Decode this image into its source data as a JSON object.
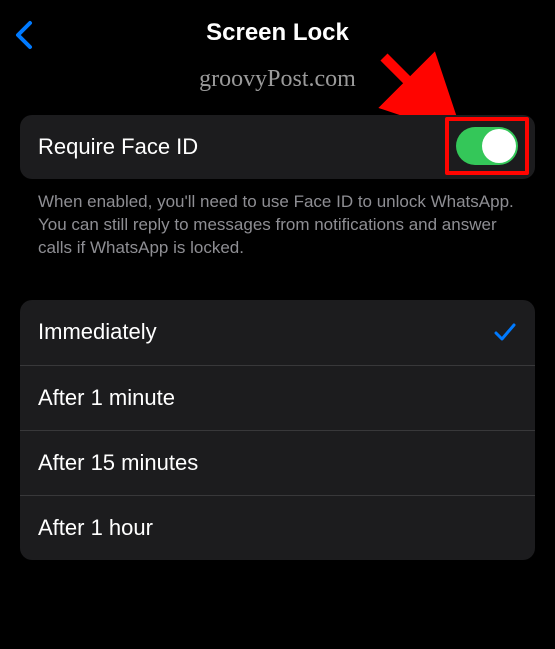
{
  "header": {
    "title": "Screen Lock"
  },
  "watermark": "groovyPost.com",
  "setting": {
    "label": "Require Face ID",
    "enabled": true,
    "description": "When enabled, you'll need to use Face ID to unlock WhatsApp. You can still reply to messages from notifications and answer calls if WhatsApp is locked."
  },
  "options": [
    {
      "label": "Immediately",
      "selected": true
    },
    {
      "label": "After 1 minute",
      "selected": false
    },
    {
      "label": "After 15 minutes",
      "selected": false
    },
    {
      "label": "After 1 hour",
      "selected": false
    }
  ],
  "colors": {
    "accent": "#007aff",
    "toggleOn": "#34c759",
    "highlight": "#ff0400"
  }
}
